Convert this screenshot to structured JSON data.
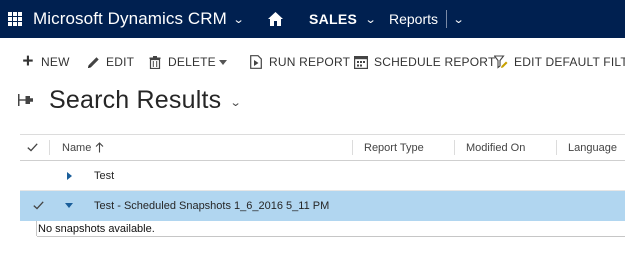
{
  "topnav": {
    "app_title": "Microsoft Dynamics CRM",
    "area": "SALES",
    "entity": "Reports",
    "background_color": "#002050",
    "icons": [
      "app-grid-icon",
      "chevron-down-icon",
      "home-icon"
    ]
  },
  "commands": {
    "new": "NEW",
    "edit": "EDIT",
    "delete": "DELETE",
    "run_report": "RUN REPORT",
    "schedule_report": "SCHEDULE REPORT",
    "edit_default_filter": "EDIT DEFAULT FILTER"
  },
  "page": {
    "title": "Search Results"
  },
  "grid": {
    "columns": {
      "name": "Name",
      "report_type": "Report Type",
      "modified_on": "Modified On",
      "language": "Language"
    },
    "sort": {
      "column": "name",
      "direction": "ascending"
    },
    "rows": [
      {
        "name": "Test",
        "report_type": "",
        "modified_on": "",
        "language": "",
        "expanded": false,
        "selected": false
      },
      {
        "name": "Test - Scheduled Snapshots 1_6_2016 5_11 PM",
        "report_type": "",
        "modified_on": "",
        "language": "",
        "expanded": true,
        "selected": true
      }
    ],
    "sub_message": "No snapshots available.",
    "selected_row_color": "#b1d6f0"
  }
}
